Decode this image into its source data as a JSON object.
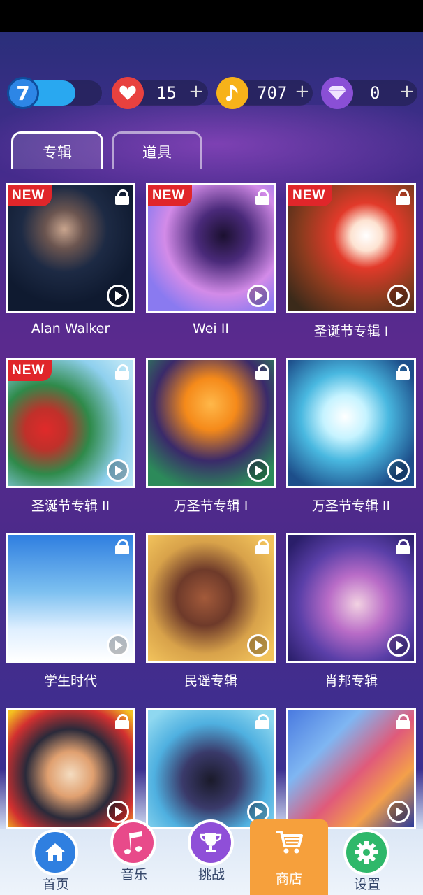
{
  "status": {
    "level": "7",
    "hearts": "15",
    "notes": "707",
    "gems": "0",
    "plus": "+"
  },
  "tabs": [
    {
      "label": "专辑",
      "active": true
    },
    {
      "label": "道具",
      "active": false
    }
  ],
  "new_badge": "NEW",
  "albums": [
    {
      "title": "Alan Walker",
      "new": true,
      "locked": true
    },
    {
      "title": "Wei II",
      "new": true,
      "locked": true
    },
    {
      "title": "圣诞节专辑 I",
      "new": true,
      "locked": true
    },
    {
      "title": "圣诞节专辑 II",
      "new": true,
      "locked": true
    },
    {
      "title": "万圣节专辑 I",
      "new": false,
      "locked": true
    },
    {
      "title": "万圣节专辑 II",
      "new": false,
      "locked": true
    },
    {
      "title": "学生时代",
      "new": false,
      "locked": true
    },
    {
      "title": "民谣专辑",
      "new": false,
      "locked": true
    },
    {
      "title": "肖邦专辑",
      "new": false,
      "locked": true
    },
    {
      "title": "",
      "new": false,
      "locked": true
    },
    {
      "title": "",
      "new": false,
      "locked": true
    },
    {
      "title": "",
      "new": false,
      "locked": true
    }
  ],
  "nav": [
    {
      "label": "首页",
      "icon": "home-icon",
      "color": "#2f7fe0",
      "active": false
    },
    {
      "label": "音乐",
      "icon": "music-note-icon",
      "color": "#e84a8a",
      "active": false
    },
    {
      "label": "挑战",
      "icon": "trophy-icon",
      "color": "#8f4fd8",
      "active": false
    },
    {
      "label": "商店",
      "icon": "shopping-cart-icon",
      "color": "#f6a03c",
      "active": true
    },
    {
      "label": "设置",
      "icon": "gear-icon",
      "color": "#2fb86a",
      "active": false
    }
  ],
  "colors": {
    "heart": "#e8413f",
    "note": "#f7b21a",
    "gem": "#8a4fd6",
    "level": "#29a8f0"
  }
}
